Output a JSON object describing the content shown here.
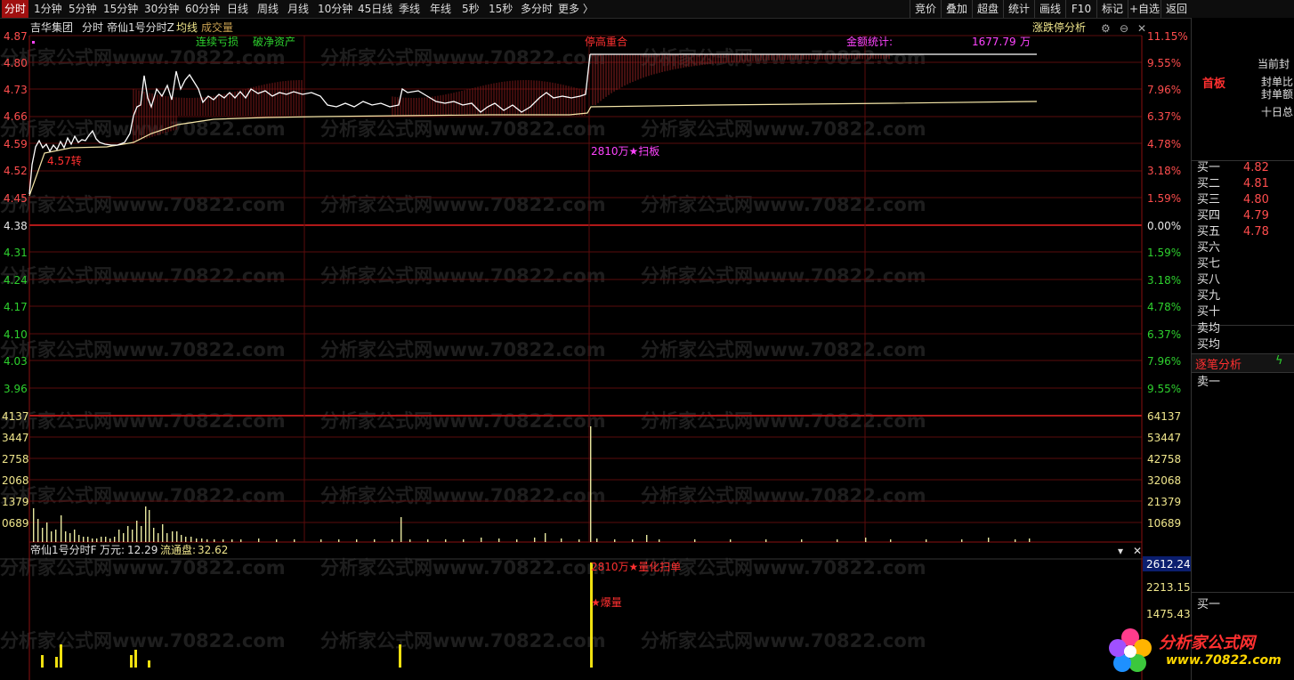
{
  "toolbar": {
    "tabs": [
      "分时",
      "1分钟",
      "5分钟",
      "15分钟",
      "30分钟",
      "60分钟",
      "日线",
      "周线",
      "月线",
      "10分钟",
      "45日线",
      "季线",
      "年线",
      "5秒",
      "15秒",
      "多分时",
      "更多 〉"
    ],
    "right_buttons": [
      "竞价",
      "叠加",
      "超盘",
      "统计",
      "画线",
      "F10",
      "标记",
      "+自选",
      "返回"
    ]
  },
  "header": {
    "stock_name": "吉华集团",
    "mode": "分时",
    "indicator": "帝仙1号分时Z",
    "avg_label": "均线",
    "vol_label": "成交量",
    "analysis": "涨跌停分析",
    "annot_loss": "连续亏损",
    "annot_nav": "破净资产",
    "annot_limit": "停高重合",
    "amount_label": "金额统计:",
    "amount_value": "1677.79",
    "amount_unit": "万",
    "signal_low": "4.57转",
    "signal_sweep": "2810万★扫板"
  },
  "axes": {
    "price_ticks": [
      "4.87",
      "4.80",
      "4.73",
      "4.66",
      "4.59",
      "4.52",
      "4.45",
      "4.38",
      "4.31",
      "4.24",
      "4.17",
      "4.10",
      "4.03",
      "3.96"
    ],
    "pct_ticks": [
      "11.15%",
      "9.55%",
      "7.96%",
      "6.37%",
      "4.78%",
      "3.18%",
      "1.59%",
      "0.00%",
      "1.59%",
      "3.18%",
      "4.78%",
      "6.37%",
      "7.96%",
      "9.55%"
    ],
    "vol_left_ticks": [
      "4137",
      "3447",
      "2758",
      "2068",
      "1379",
      "0689"
    ],
    "vol_right_ticks": [
      "64137",
      "53447",
      "42758",
      "32068",
      "21379",
      "10689"
    ],
    "sub_right_ticks": [
      "2612.24",
      "2213.15",
      "1475.43"
    ]
  },
  "subchart": {
    "title": "帝仙1号分时F",
    "field1_label": "万元:",
    "field1_value": "12.29",
    "field2_label": "流通盘:",
    "field2_value": "32.62",
    "signal_quant": "2810万★量化扫单",
    "signal_burst": "★爆量"
  },
  "right_panel": {
    "info_rows": [
      "当前封",
      "封单比",
      "封单额",
      "十日总"
    ],
    "first_board": "首板",
    "bids": [
      {
        "label": "买一",
        "price": "4.82"
      },
      {
        "label": "买二",
        "price": "4.81"
      },
      {
        "label": "买三",
        "price": "4.80"
      },
      {
        "label": "买四",
        "price": "4.79"
      },
      {
        "label": "买五",
        "price": "4.78"
      },
      {
        "label": "买六",
        "price": ""
      },
      {
        "label": "买七",
        "price": ""
      },
      {
        "label": "买八",
        "price": ""
      },
      {
        "label": "买九",
        "price": ""
      },
      {
        "label": "买十",
        "price": ""
      }
    ],
    "sell_avg": "卖均",
    "buy_avg": "买均",
    "tick_analysis": "逐笔分析",
    "sell1_a": "卖一",
    "sell1_b": "买一"
  },
  "watermark": "分析家公式网www.70822.com",
  "logo": {
    "title": "分析家公式网",
    "url": "www.70822.com"
  },
  "colors": {
    "up": "#ff3030",
    "down": "#2ed12e",
    "grid": "#7a1010",
    "price_line": "#ffffff",
    "avg_line": "#f5e6a8",
    "volume": "#e8e8a0",
    "magenta": "#ff44ff"
  }
}
